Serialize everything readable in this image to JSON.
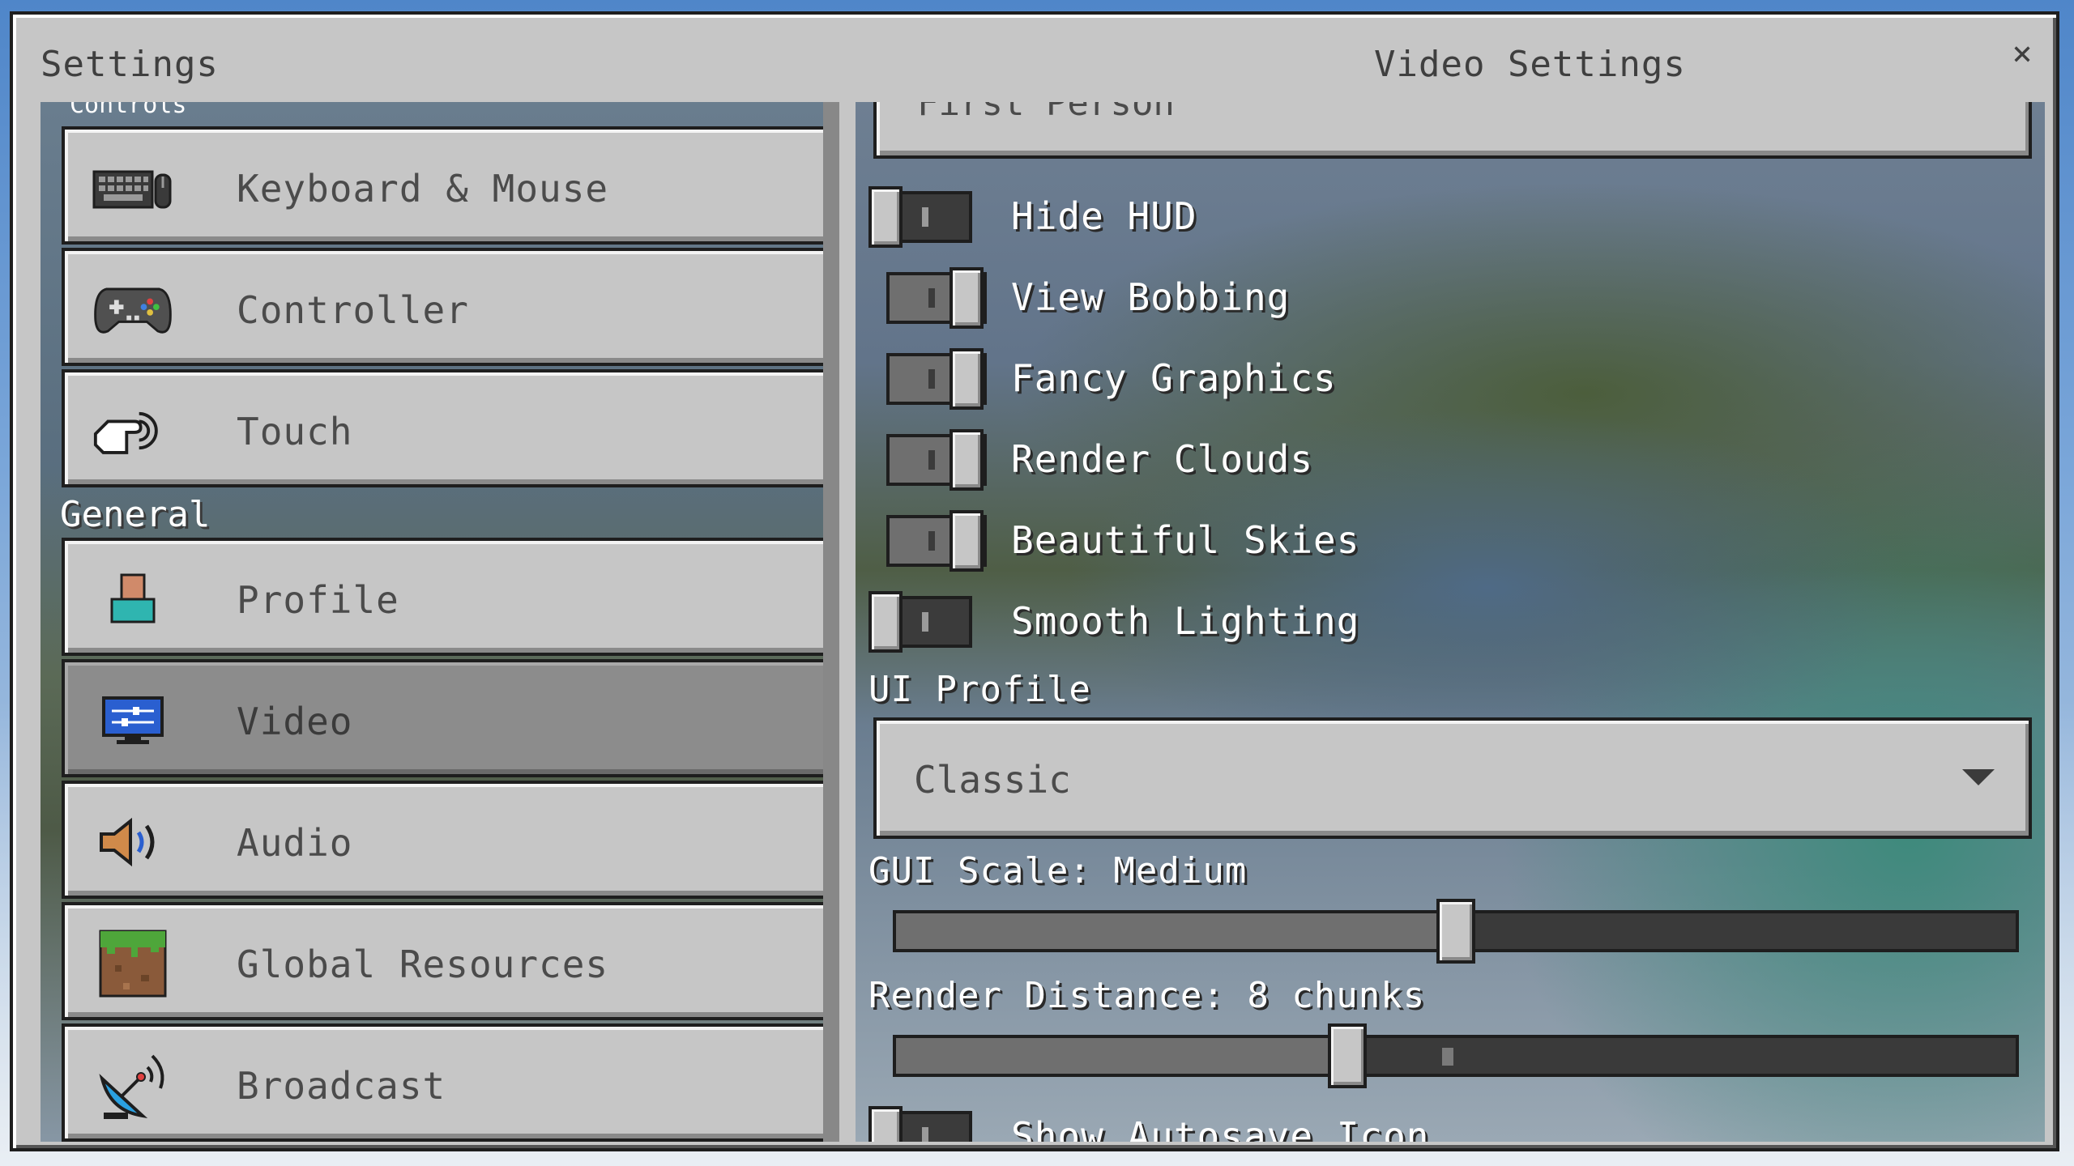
{
  "window": {
    "left_title": "Settings",
    "right_title": "Video Settings",
    "close_glyph": "×"
  },
  "nav": {
    "partial_section_text": "Controls",
    "items_controls": [
      {
        "label": "Keyboard & Mouse",
        "icon": "keyboard-mouse-icon"
      },
      {
        "label": "Controller",
        "icon": "controller-icon"
      },
      {
        "label": "Touch",
        "icon": "touch-icon"
      }
    ],
    "general_label": "General",
    "items_general": [
      {
        "label": "Profile",
        "icon": "profile-icon"
      },
      {
        "label": "Video",
        "icon": "video-icon",
        "selected": true
      },
      {
        "label": "Audio",
        "icon": "audio-icon"
      },
      {
        "label": "Global Resources",
        "icon": "grass-block-icon"
      },
      {
        "label": "Broadcast",
        "icon": "satellite-dish-icon"
      }
    ]
  },
  "video": {
    "camera_dropdown_partial": "First Person",
    "toggles": [
      {
        "label": "Hide HUD",
        "on": false
      },
      {
        "label": "View Bobbing",
        "on": true
      },
      {
        "label": "Fancy Graphics",
        "on": true
      },
      {
        "label": "Render Clouds",
        "on": true
      },
      {
        "label": "Beautiful Skies",
        "on": true
      },
      {
        "label": "Smooth Lighting",
        "on": false
      }
    ],
    "ui_profile_label": "UI Profile",
    "ui_profile_value": "Classic",
    "gui_scale_label": "GUI Scale: Medium",
    "gui_scale_fraction": 0.5,
    "render_distance_label": "Render Distance: 8 chunks",
    "render_distance_fraction": 0.4,
    "autosave_label": "Show Autosave Icon"
  },
  "colors": {
    "panel": "#c6c6c6",
    "selected": "#8c8c8c",
    "border": "#1e1e1e"
  }
}
